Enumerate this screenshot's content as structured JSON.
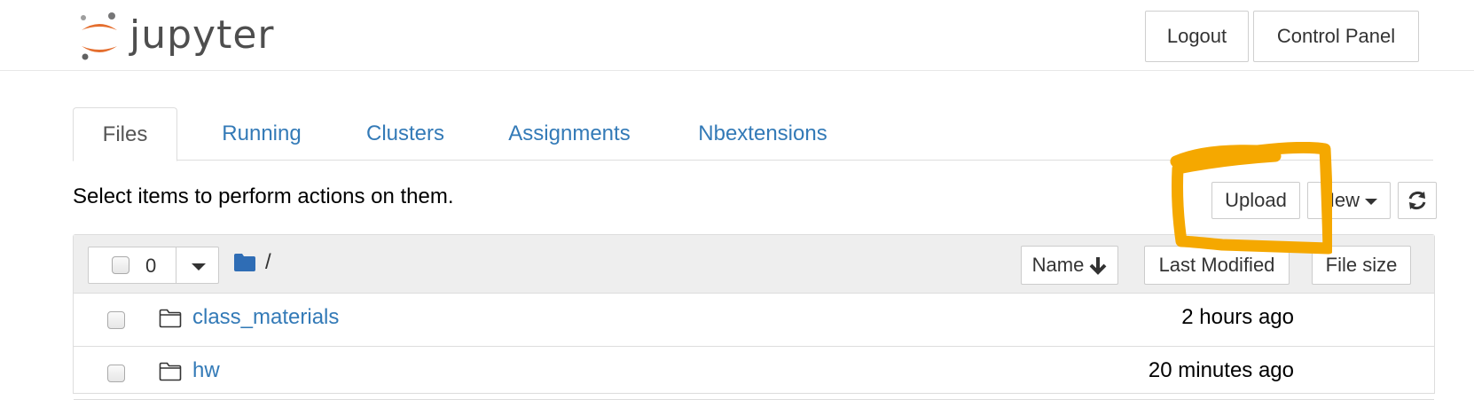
{
  "header": {
    "logo_text": "jupyter",
    "logout_label": "Logout",
    "control_panel_label": "Control Panel"
  },
  "tabs": [
    {
      "label": "Files",
      "active": true
    },
    {
      "label": "Running",
      "active": false
    },
    {
      "label": "Clusters",
      "active": false
    },
    {
      "label": "Assignments",
      "active": false
    },
    {
      "label": "Nbextensions",
      "active": false
    }
  ],
  "toolbar": {
    "instruction_text": "Select items to perform actions on them.",
    "upload_label": "Upload",
    "new_label": "New",
    "refresh_icon": "refresh-icon"
  },
  "list_header": {
    "selected_count": "0",
    "breadcrumb_sep": "/",
    "sort_name_label": "Name",
    "sort_last_modified_label": "Last Modified",
    "sort_file_size_label": "File size"
  },
  "rows": [
    {
      "name": "class_materials",
      "modified": "2 hours ago",
      "icon": "folder-icon"
    },
    {
      "name": "hw",
      "modified": "20 minutes ago",
      "icon": "folder-icon"
    }
  ],
  "colors": {
    "link": "#337ab7",
    "annotation": "#f5a800",
    "logo_orange": "#e46e2e",
    "folder_blue": "#2f6db5"
  }
}
